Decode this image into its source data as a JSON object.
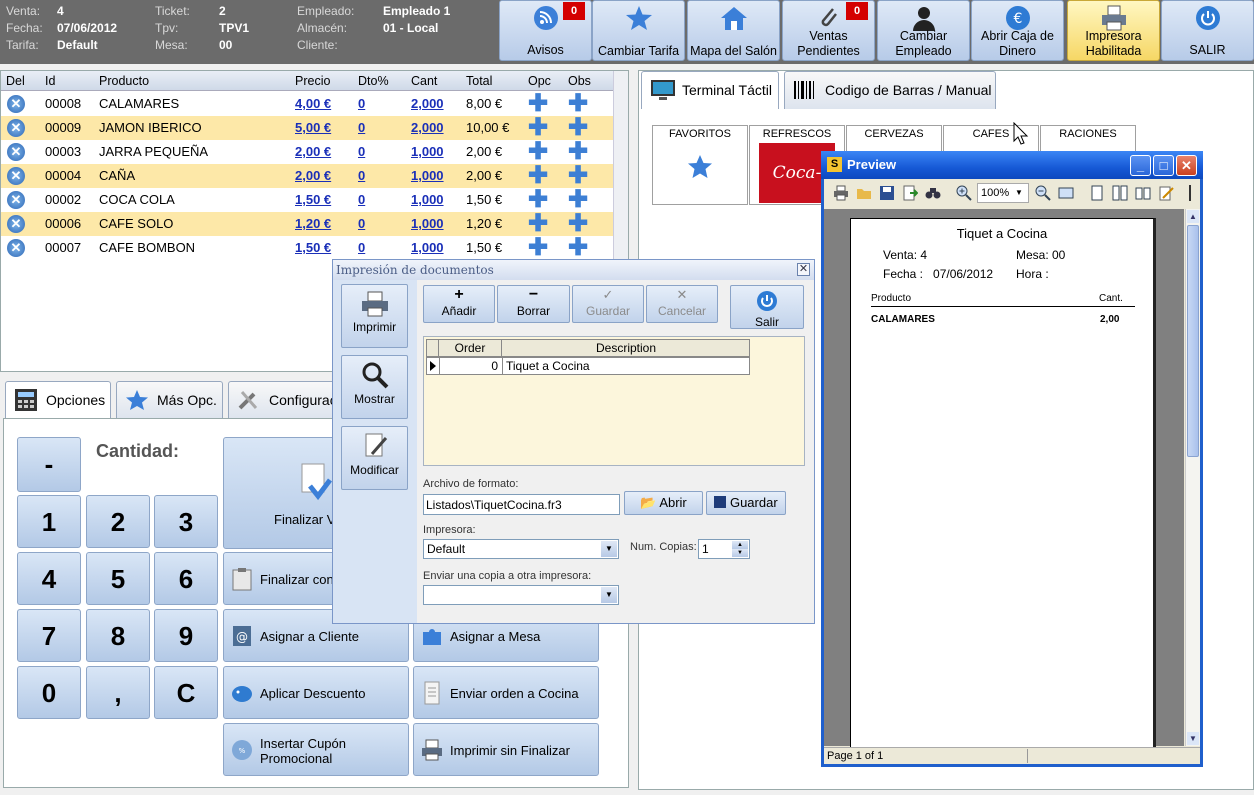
{
  "header": {
    "venta_label": "Venta:",
    "venta": "4",
    "fecha_label": "Fecha:",
    "fecha": "07/06/2012",
    "tarifa_label": "Tarifa:",
    "tarifa": "Default",
    "ticket_label": "Ticket:",
    "ticket": "2",
    "tpv_label": "Tpv:",
    "tpv": "TPV1",
    "mesa_label": "Mesa:",
    "mesa": "00",
    "empleado_label": "Empleado:",
    "empleado": "Empleado 1",
    "almacen_label": "Almacén:",
    "almacen": "01 - Local",
    "cliente_label": "Cliente:",
    "cliente": ""
  },
  "toolbar": [
    {
      "label": "Avisos",
      "badge": "0",
      "icon": "rss-icon"
    },
    {
      "label": "Cambiar Tarifa",
      "icon": "star-icon"
    },
    {
      "label": "Mapa del Salón",
      "icon": "house-icon"
    },
    {
      "label": "Ventas Pendientes",
      "badge": "0",
      "icon": "paperclip-icon"
    },
    {
      "label": "Cambiar Empleado",
      "icon": "user-icon"
    },
    {
      "label": "Abrir Caja de Dinero",
      "icon": "euro-icon"
    },
    {
      "label": "Impresora Habilitada",
      "icon": "printer-icon",
      "active": true
    },
    {
      "label": "SALIR",
      "icon": "power-icon"
    }
  ],
  "grid": {
    "columns": [
      "Del",
      "Id",
      "Producto",
      "Precio",
      "Dto%",
      "Cant",
      "Total",
      "Opc",
      "Obs"
    ],
    "rows": [
      {
        "id": "00008",
        "producto": "CALAMARES",
        "precio": "4,00 €",
        "dto": "0",
        "cant": "2,000",
        "total": "8,00 €"
      },
      {
        "id": "00009",
        "producto": "JAMON IBERICO",
        "precio": "5,00 €",
        "dto": "0",
        "cant": "2,000",
        "total": "10,00 €"
      },
      {
        "id": "00003",
        "producto": "JARRA PEQUEÑA",
        "precio": "2,00 €",
        "dto": "0",
        "cant": "1,000",
        "total": "2,00 €"
      },
      {
        "id": "00004",
        "producto": "CAÑA",
        "precio": "2,00 €",
        "dto": "0",
        "cant": "1,000",
        "total": "2,00 €"
      },
      {
        "id": "00002",
        "producto": "COCA COLA",
        "precio": "1,50 €",
        "dto": "0",
        "cant": "1,000",
        "total": "1,50 €"
      },
      {
        "id": "00006",
        "producto": "CAFE SOLO",
        "precio": "1,20 €",
        "dto": "0",
        "cant": "1,000",
        "total": "1,20 €"
      },
      {
        "id": "00007",
        "producto": "CAFE BOMBON",
        "precio": "1,50 €",
        "dto": "0",
        "cant": "1,000",
        "total": "1,50 €"
      }
    ]
  },
  "bottom_tabs": [
    "Opciones",
    "Más Opc.",
    "Configurac"
  ],
  "cantidad_label": "Cantidad:",
  "numpad": [
    "-",
    "1",
    "2",
    "3",
    "4",
    "5",
    "6",
    "7",
    "8",
    "9",
    "0",
    ",",
    "C"
  ],
  "actions": {
    "finalizar_venta": "Finalizar V",
    "finalizar_con": "Finalizar con",
    "asignar_cliente": "Asignar a Cliente",
    "asignar_mesa": "Asignar a Mesa",
    "aplicar_descuento": "Aplicar Descuento",
    "enviar_cocina": "Enviar orden a Cocina",
    "insertar_cupon": "Insertar Cupón Promocional",
    "imprimir_sin": "Imprimir sin Finalizar"
  },
  "right_tabs": [
    "Terminal Táctil",
    "Codigo de Barras / Manual"
  ],
  "categories": [
    "FAVORITOS",
    "REFRESCOS",
    "CERVEZAS",
    "CAFES",
    "RACIONES"
  ],
  "dialog": {
    "title": "Impresión de documentos",
    "side": [
      "Imprimir",
      "Mostrar",
      "Modificar"
    ],
    "buttons": [
      "Añadir",
      "Borrar",
      "Guardar",
      "Cancelar"
    ],
    "salir": "Salir",
    "table_cols": [
      "Order",
      "Description"
    ],
    "table_row": {
      "order": "0",
      "description": "Tiquet a Cocina"
    },
    "archivo_label": "Archivo de formato:",
    "archivo_value": "Listados\\TiquetCocina.fr3",
    "abrir": "Abrir",
    "guardar": "Guardar",
    "impresora_label": "Impresora:",
    "impresora_value": "Default",
    "copias_label": "Num. Copias:",
    "copias_value": "1",
    "otra_label": "Enviar una copia a otra impresora:"
  },
  "preview": {
    "title": "Preview",
    "zoom": "100%",
    "doc_title": "Tiquet a Cocina",
    "venta": "Venta: 4",
    "mesa": "Mesa: 00",
    "fecha": "Fecha :   07/06/2012",
    "hora": "Hora :",
    "col_producto": "Producto",
    "col_cant": "Cant.",
    "item_name": "CALAMARES",
    "item_cant": "2,00",
    "status": "Page 1 of 1"
  },
  "colors": {
    "header_bg": "#6b6b6b",
    "row_alt": "#fde8a8",
    "link": "#1a2fb8",
    "title_blue": "#1659d6"
  }
}
